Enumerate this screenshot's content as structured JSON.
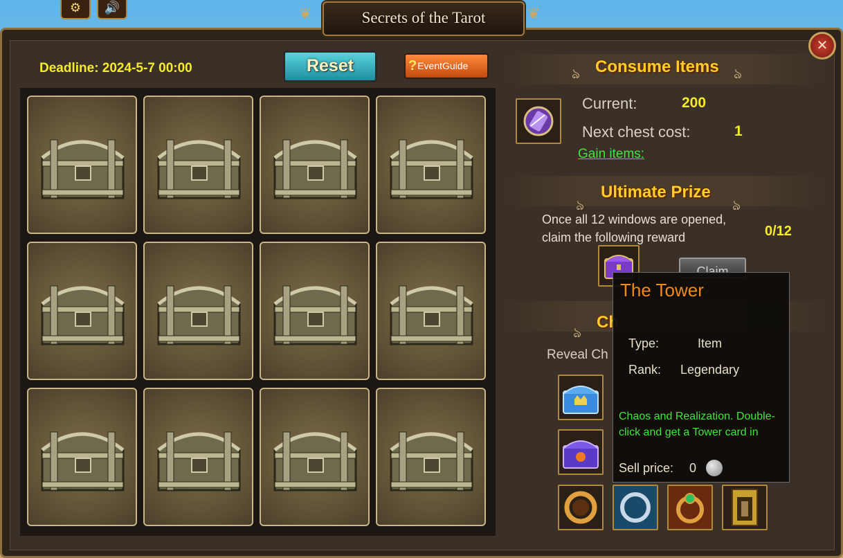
{
  "window": {
    "title": "Secrets of the Tarot"
  },
  "toolbar": {
    "reset_label": "Reset",
    "guide_label": "EventGuide",
    "guide_icon": "?"
  },
  "deadline": "Deadline: 2024-5-7 00:00",
  "grid": {
    "rows": 3,
    "cols": 4,
    "chest_count": 12
  },
  "consume": {
    "title": "Consume Items",
    "current_label": "Current:",
    "current_value": "200",
    "next_cost_label": "Next chest cost:",
    "next_cost_value": "1",
    "gain_link": "Gain items:"
  },
  "ultimate": {
    "title": "Ultimate Prize",
    "description": "Once all 12 windows are opened, claim the following reward",
    "progress": "0/12",
    "claim_label": "Claim"
  },
  "chest_section": {
    "title_partial": "Ch",
    "reveal_partial": "Reveal Ch"
  },
  "tooltip": {
    "title": "The Tower",
    "type_label": "Type:",
    "type_value": "Item",
    "rank_label": "Rank:",
    "rank_value": "Legendary",
    "description": "Chaos and Realization. Double-click and get a Tower card in",
    "sell_label": "Sell price:",
    "sell_value": "0"
  },
  "colors": {
    "accent_yellow": "#f6ec2a",
    "title_gold": "#ffcc2a",
    "link_green": "#3ee83a",
    "tooltip_title": "#f08a1c"
  },
  "icons": [
    "gear-icon",
    "speaker-icon",
    "close-icon",
    "question-icon",
    "tarot-token-icon",
    "purple-chest-icon",
    "blue-crown-chest-icon",
    "purple-star-chest-icon",
    "gold-ring-icon",
    "silver-ring-icon",
    "gem-ring-icon",
    "tower-card-icon",
    "silver-coin-icon"
  ]
}
